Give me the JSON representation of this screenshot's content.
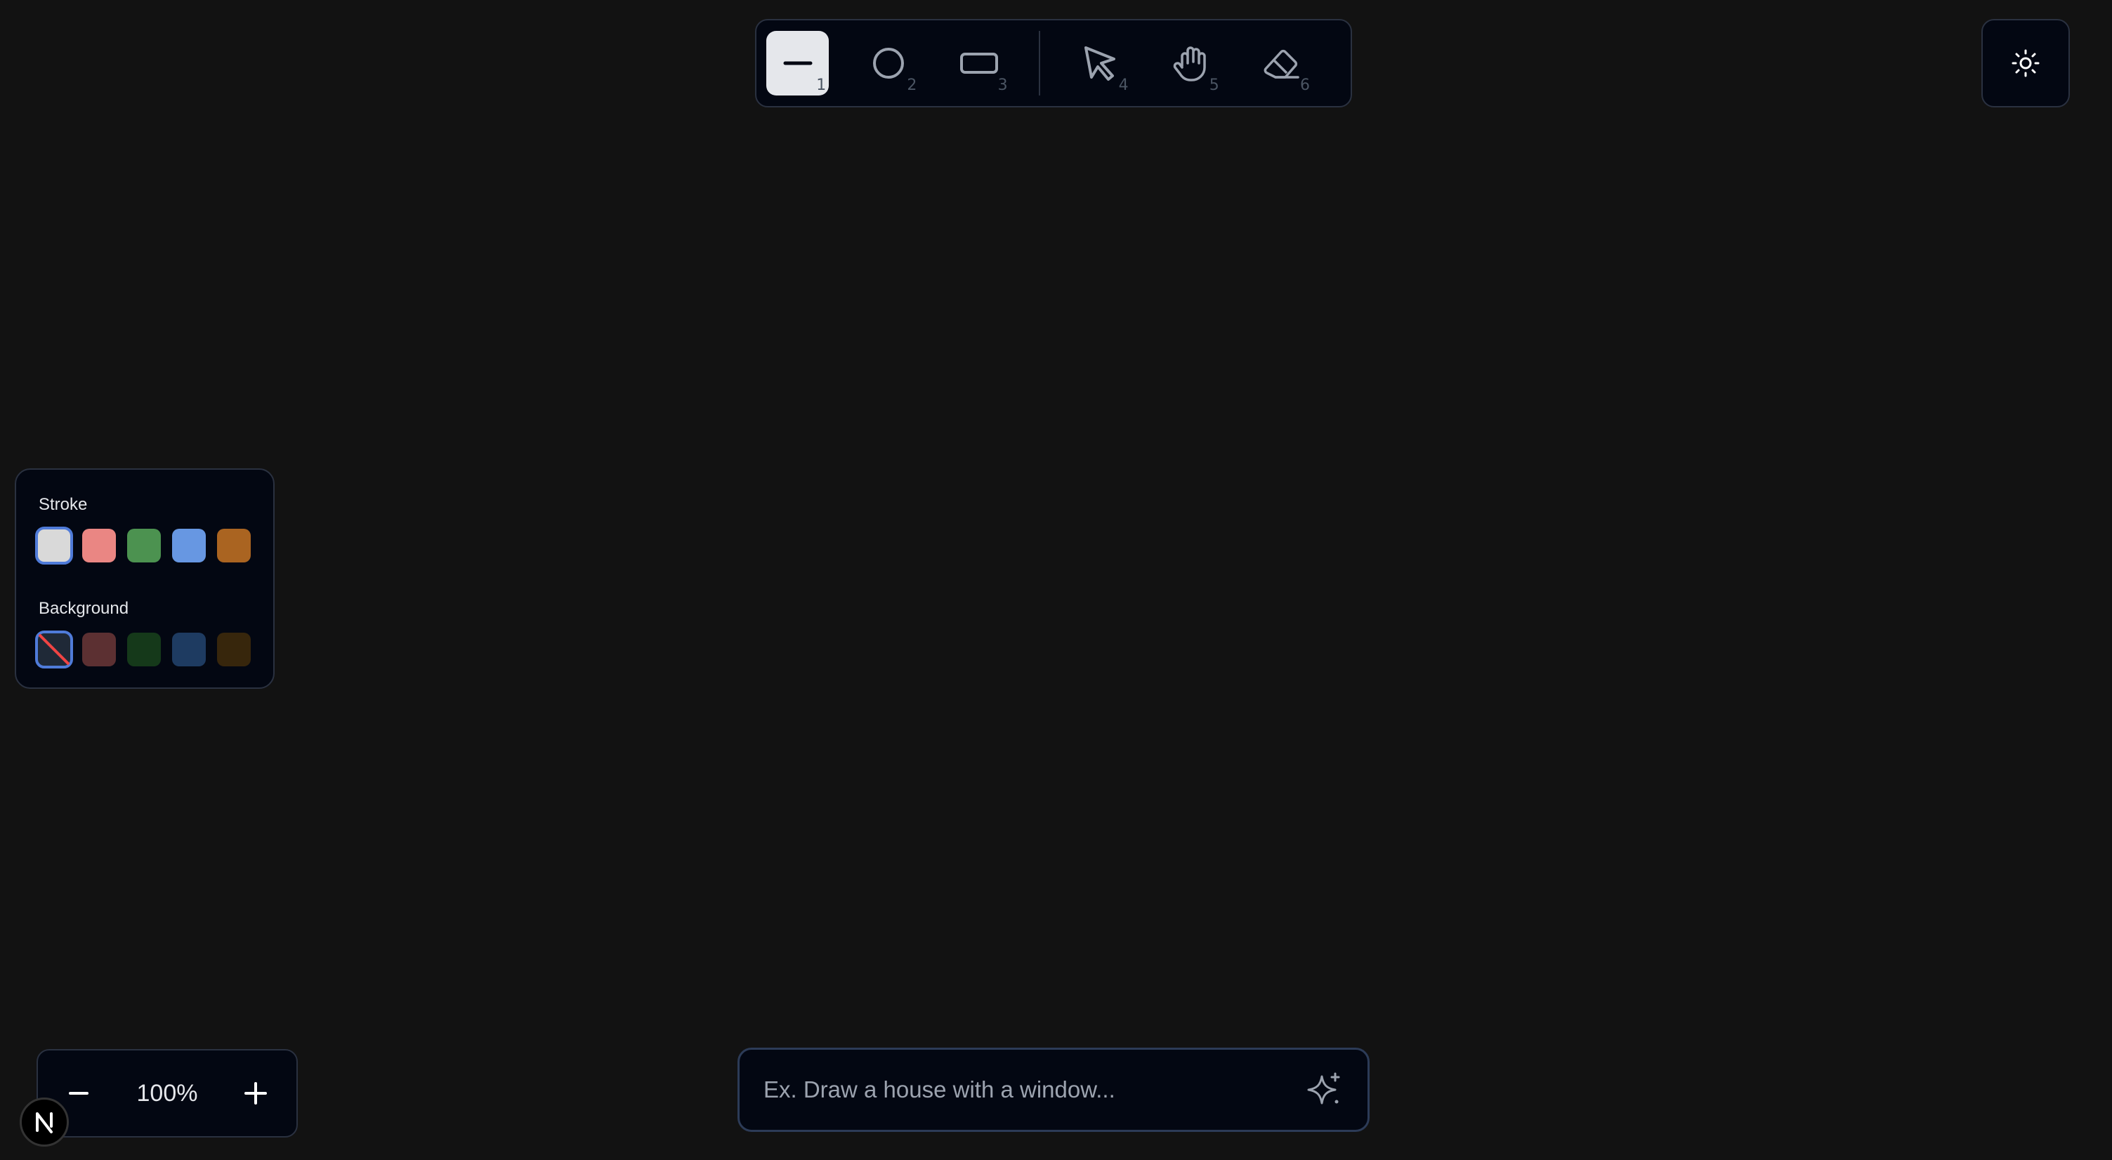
{
  "toolbar": {
    "tools": [
      {
        "name": "line",
        "key": "1",
        "active": true
      },
      {
        "name": "circle",
        "key": "2",
        "active": false
      },
      {
        "name": "rectangle",
        "key": "3",
        "active": false
      },
      {
        "name": "select",
        "key": "4",
        "active": false
      },
      {
        "name": "pan",
        "key": "5",
        "active": false
      },
      {
        "name": "eraser",
        "key": "6",
        "active": false
      }
    ]
  },
  "color_panel": {
    "stroke_label": "Stroke",
    "stroke_colors": [
      "#d9d9d9",
      "#ea8683",
      "#4c9250",
      "#6797e2",
      "#aa6421"
    ],
    "stroke_selected": 0,
    "background_label": "Background",
    "background_colors": [
      "transparent",
      "#5c3032",
      "#15391a",
      "#1e3b61",
      "#37260c"
    ],
    "background_selected": 0
  },
  "zoom": {
    "value": "100%"
  },
  "prompt": {
    "placeholder": "Ex. Draw a house with a window..."
  },
  "colors": {
    "canvas": "#121212",
    "panel": "#030712",
    "border": "#2a3140",
    "selection": "#4f7bd9"
  }
}
